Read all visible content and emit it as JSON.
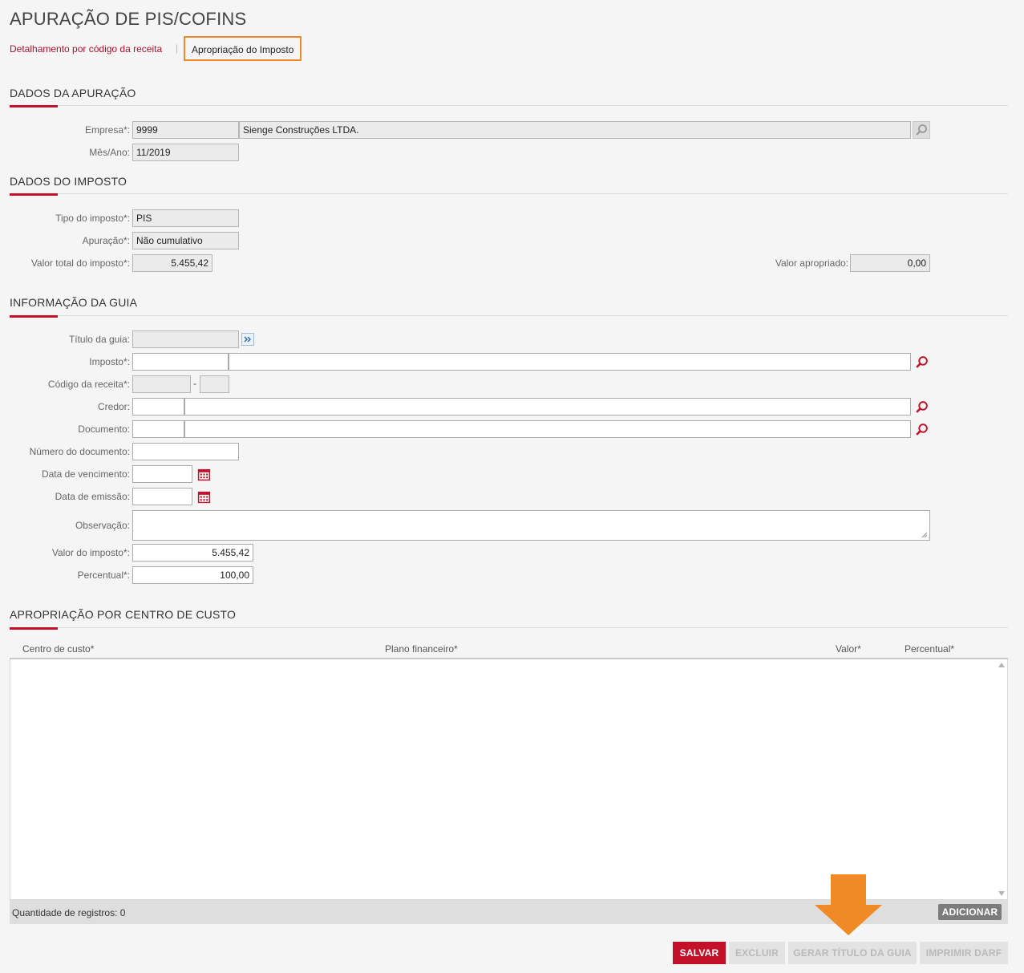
{
  "title": "APURAÇÃO DE PIS/COFINS",
  "tabs": {
    "link": "Detalhamento por código da receita",
    "separator": "|",
    "active": "Apropriação do Imposto"
  },
  "section_apuracao": {
    "title": "DADOS DA APURAÇÃO",
    "empresa_label": "Empresa*:",
    "empresa_code": "9999",
    "empresa_name": "Sienge Construções LTDA.",
    "mes_label": "Mês/Ano:",
    "mes_value": "11/2019"
  },
  "section_imposto": {
    "title": "DADOS DO IMPOSTO",
    "tipo_label": "Tipo do imposto*:",
    "tipo_value": "PIS",
    "apuracao_label": "Apuração*:",
    "apuracao_value": "Não cumulativo",
    "valor_total_label": "Valor total do imposto*:",
    "valor_total_value": "5.455,42",
    "valor_apropriado_label": "Valor apropriado:",
    "valor_apropriado_value": "0,00"
  },
  "section_guia": {
    "title": "INFORMAÇÃO DA GUIA",
    "titulo_label": "Título da guia:",
    "titulo_value": "",
    "imposto_label": "Imposto*:",
    "imposto_code": "",
    "imposto_name": "",
    "codigo_label": "Código da receita*:",
    "codigo_dash": "-",
    "credor_label": "Credor:",
    "documento_label": "Documento:",
    "numero_label": "Número do documento:",
    "vencimento_label": "Data de vencimento:",
    "emissao_label": "Data de emissão:",
    "observacao_label": "Observação:",
    "valor_label": "Valor do imposto*:",
    "valor_value": "5.455,42",
    "percentual_label": "Percentual*:",
    "percentual_value": "100,00"
  },
  "section_apropriacao": {
    "title": "APROPRIAÇÃO POR CENTRO DE CUSTO",
    "columns": [
      "Centro de custo*",
      "Plano financeiro*",
      "Valor*",
      "Percentual*"
    ],
    "rows": [],
    "count_text": "Quantidade de registros: 0",
    "add_button": "ADICIONAR"
  },
  "buttons": {
    "salvar": "SALVAR",
    "excluir": "EXCLUIR",
    "gerar": "GERAR TÍTULO DA GUIA",
    "imprimir": "IMPRIMIR DARF"
  },
  "colors": {
    "accent": "#c4112a",
    "highlight": "#f08a24"
  },
  "icons": [
    "search-icon",
    "forward-icon",
    "calendar-icon",
    "resize-handle-icon",
    "arrow-down-icon"
  ]
}
